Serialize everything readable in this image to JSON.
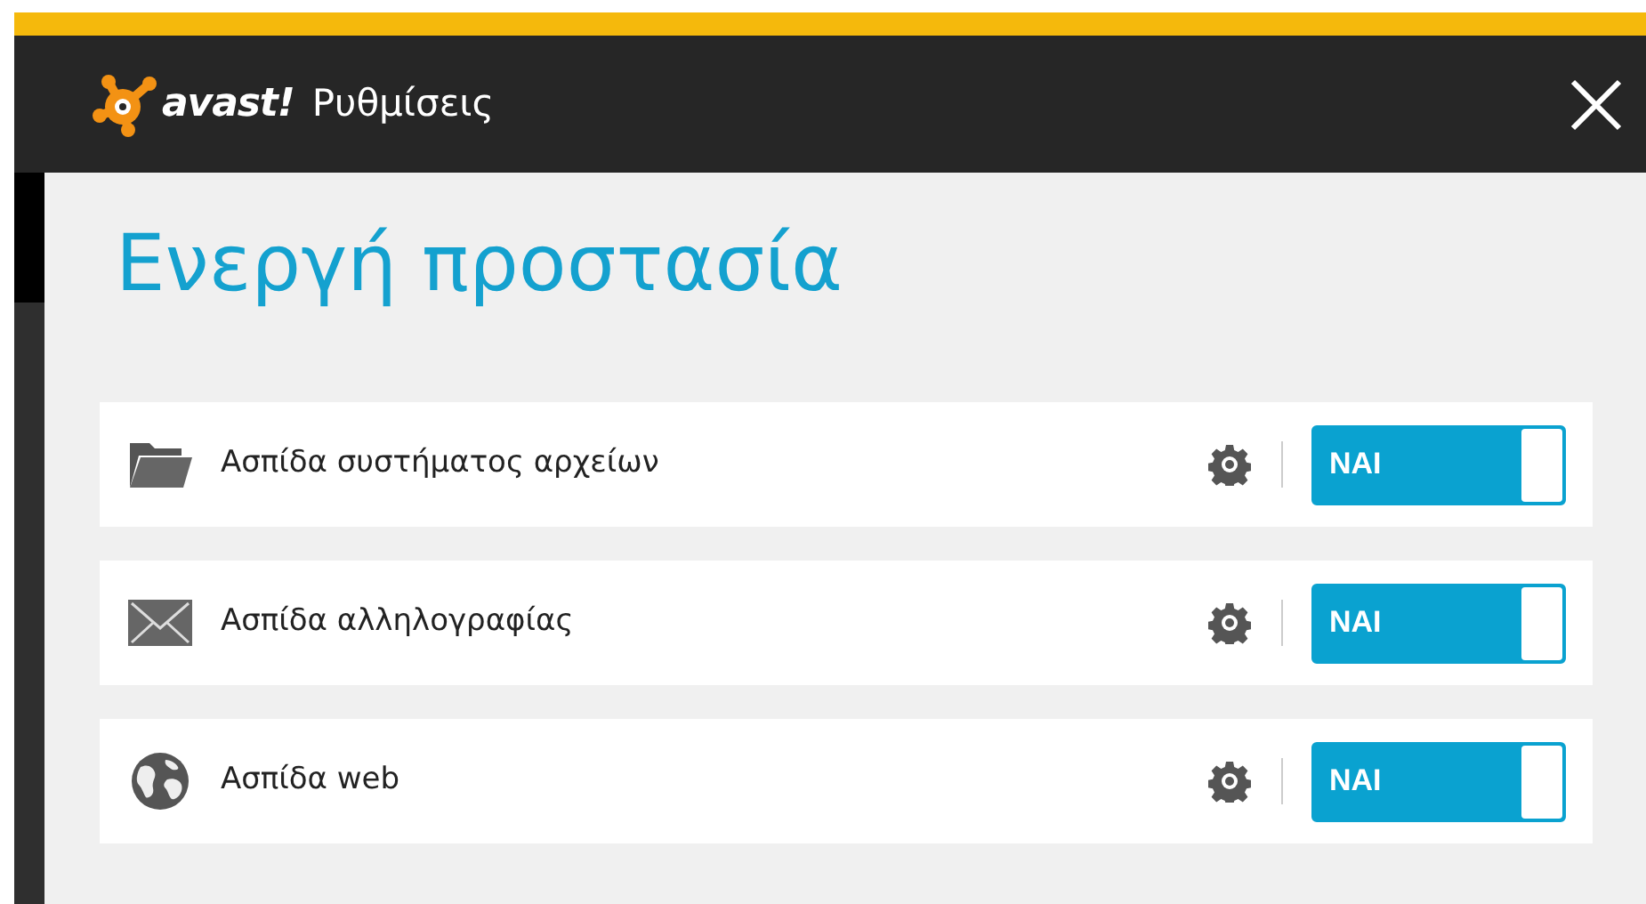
{
  "header": {
    "logo_text": "avast!",
    "title": "Ρυθμίσεις"
  },
  "page": {
    "heading": "Ενεργή προστασία"
  },
  "shields": [
    {
      "kind": "folder",
      "label": "Ασπίδα συστήματος αρχείων",
      "on": true,
      "switch_text": "NAI"
    },
    {
      "kind": "mail",
      "label": "Ασπίδα αλληλογραφίας",
      "on": true,
      "switch_text": "NAI"
    },
    {
      "kind": "globe",
      "label": "Ασπίδα web",
      "on": true,
      "switch_text": "NAI"
    }
  ]
}
